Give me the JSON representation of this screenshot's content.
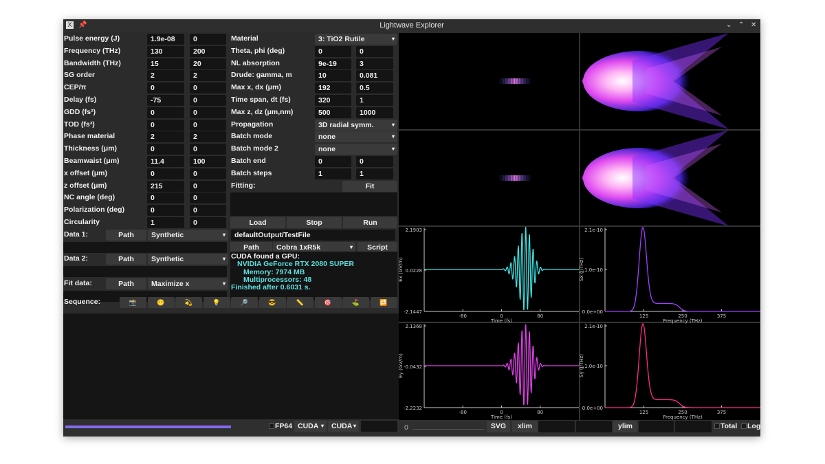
{
  "window": {
    "title": "Lightwave Explorer",
    "controls": [
      "minimize",
      "maximize",
      "close"
    ]
  },
  "left_fields": [
    {
      "label": "Pulse energy (J)",
      "v1": "1.9e-08",
      "v2": "0"
    },
    {
      "label": "Frequency (THz)",
      "v1": "130",
      "v2": "200"
    },
    {
      "label": "Bandwidth (THz)",
      "v1": "15",
      "v2": "20"
    },
    {
      "label": "SG order",
      "v1": "2",
      "v2": "2"
    },
    {
      "label": "CEP/π",
      "v1": "0",
      "v2": "0"
    },
    {
      "label": "Delay (fs)",
      "v1": "-75",
      "v2": "0"
    },
    {
      "label": "GDD (fs²)",
      "v1": "0",
      "v2": "0"
    },
    {
      "label": "TOD (fs³)",
      "v1": "0",
      "v2": "0"
    },
    {
      "label": "Phase material",
      "v1": "2",
      "v2": "2"
    },
    {
      "label": "Thickness (μm)",
      "v1": "0",
      "v2": "0"
    },
    {
      "label": "Beamwaist (μm)",
      "v1": "11.4",
      "v2": "100"
    },
    {
      "label": "x offset (μm)",
      "v1": "0",
      "v2": "0"
    },
    {
      "label": "z offset (μm)",
      "v1": "215",
      "v2": "0"
    },
    {
      "label": "NC angle (deg)",
      "v1": "0",
      "v2": "0"
    },
    {
      "label": "Polarization (deg)",
      "v1": "0",
      "v2": "0"
    },
    {
      "label": "Circularity",
      "v1": "1",
      "v2": "0"
    }
  ],
  "mid_fields": [
    {
      "label": "Material",
      "select": "3: TiO2 Rutile"
    },
    {
      "label": "Theta, phi (deg)",
      "v1": "0",
      "v2": "0"
    },
    {
      "label": "NL absorption",
      "v1": "9e-19",
      "v2": "3"
    },
    {
      "label": "Drude: gamma, m",
      "v1": "10",
      "v2": "0.081"
    },
    {
      "label": "Max x, dx (μm)",
      "v1": "192",
      "v2": "0.5"
    },
    {
      "label": "Time span, dt (fs)",
      "v1": "320",
      "v2": "1"
    },
    {
      "label": "Max z, dz (μm,nm)",
      "v1": "500",
      "v2": "1000"
    },
    {
      "label": "Propagation",
      "select": "3D radial symm."
    },
    {
      "label": "Batch mode",
      "select": "none"
    },
    {
      "label": "Batch mode 2",
      "select": "none"
    },
    {
      "label": "Batch end",
      "v1": "0",
      "v2": "0"
    },
    {
      "label": "Batch steps",
      "v1": "1",
      "v2": "1"
    }
  ],
  "fitting": {
    "label": "Fitting:",
    "fit_button": "Fit",
    "text": ""
  },
  "run_buttons": {
    "load": "Load",
    "stop": "Stop",
    "run": "Run"
  },
  "data_rows": [
    {
      "label": "Data 1:",
      "path_button": "Path",
      "select": "Synthetic",
      "path": ""
    },
    {
      "label": "Data 2:",
      "path_button": "Path",
      "select": "Synthetic",
      "path": ""
    },
    {
      "label": "Fit data:",
      "path_button": "Path",
      "select": "Maximize x",
      "path": ""
    }
  ],
  "output": {
    "file": "defaultOutput/TestFile",
    "path_button": "Path",
    "cluster_select": "Cobra 1xR5k",
    "script_button": "Script"
  },
  "console": {
    "lines": [
      {
        "text": "CUDA found a GPU:",
        "indent": 0,
        "kind": "h"
      },
      {
        "text": "NVIDIA GeForce RTX 2080 SUPER",
        "indent": 1,
        "kind": "c"
      },
      {
        "text": "Memory: 7974 MB",
        "indent": 2,
        "kind": "c"
      },
      {
        "text": "Multiprocessors: 48",
        "indent": 2,
        "kind": "c"
      },
      {
        "text": "Finished after 0.6031 s.",
        "indent": 0,
        "kind": "c"
      }
    ]
  },
  "sequence": {
    "label": "Sequence:",
    "buttons": [
      {
        "name": "camera",
        "glyph": "📸"
      },
      {
        "name": "pause-face",
        "glyph": "😶"
      },
      {
        "name": "dizzy",
        "glyph": "💫"
      },
      {
        "name": "light-bulb",
        "glyph": "💡"
      },
      {
        "name": "magnifier",
        "glyph": "🔎"
      },
      {
        "name": "sunglasses",
        "glyph": "😎"
      },
      {
        "name": "ruler",
        "glyph": "📏"
      },
      {
        "name": "target",
        "glyph": "🎯"
      },
      {
        "name": "golf-flag",
        "glyph": "⛳"
      },
      {
        "name": "repeat",
        "glyph": "🔁"
      }
    ]
  },
  "bottom": {
    "progress": 1.0,
    "progress_color": "#9b59ff",
    "fp64_label": "FP64",
    "fp64_checked": false,
    "primary_backend": "CUDA",
    "secondary_backend": "CUDA",
    "backend_field": "",
    "slider_value": "0",
    "svg_button": "SVG",
    "xlim_button": "xlim",
    "xlim_min": "",
    "xlim_max": "",
    "ylim_button": "ylim",
    "ylim_min": "",
    "ylim_max": "",
    "total_label": "Total",
    "total_checked": false,
    "log_label": "Log",
    "log_checked": false
  },
  "colors": {
    "ex": "#3ee0e0",
    "ey": "#e040e8",
    "sx": "#a040ff",
    "sy": "#ff2a8a",
    "beam_core": "#ff9cf0",
    "beam_edge": "#5a2cff"
  },
  "chart_data": [
    {
      "type": "line",
      "ylabel": "Ex (GV/m)",
      "xlabel": "Time (fs)",
      "xlim": [
        -160,
        160
      ],
      "x_ticks": [
        "-80",
        "0",
        "80"
      ],
      "y_ticks": [
        "2.1903",
        "0.0228",
        "-2.1447"
      ],
      "ylim": [
        -2.1447,
        2.1903
      ],
      "series": [
        {
          "color": "#3ee0e0",
          "center_fs": 50,
          "peak": 2.19,
          "carrier_THz": 130
        }
      ]
    },
    {
      "type": "line",
      "ylabel": "Sx (J/THz)",
      "xlabel": "Frequency (THz)",
      "xlim": [
        0,
        500
      ],
      "x_ticks": [
        "125",
        "250",
        "375"
      ],
      "y_ticks": [
        "2.1e-10",
        "1.0e-10",
        "0.0e+00"
      ],
      "ylim": [
        0,
        2.1e-10
      ],
      "series": [
        {
          "color": "#a040ff",
          "peak_THz": 122,
          "peak": 2.1e-10,
          "shoulder": 2e-11
        }
      ]
    },
    {
      "type": "line",
      "ylabel": "Ey (GV/m)",
      "xlabel": "Time (fs)",
      "xlim": [
        -160,
        160
      ],
      "x_ticks": [
        "-80",
        "0",
        "80"
      ],
      "y_ticks": [
        "2.1368",
        "-0.0432",
        "-2.2232"
      ],
      "ylim": [
        -2.2232,
        2.1368
      ],
      "series": [
        {
          "color": "#e040e8",
          "center_fs": 50,
          "peak": 2.14,
          "carrier_THz": 130
        }
      ]
    },
    {
      "type": "line",
      "ylabel": "Sy (J/THz)",
      "xlabel": "Frequency (THz)",
      "xlim": [
        0,
        500
      ],
      "x_ticks": [
        "125",
        "250",
        "375"
      ],
      "y_ticks": [
        "2.1e-10",
        "1.0e-10",
        "0.0e+00"
      ],
      "ylim": [
        0,
        2.1e-10
      ],
      "series": [
        {
          "color": "#ff2a8a",
          "peak_THz": 122,
          "peak": 2.1e-10,
          "shoulder": 2e-11
        }
      ]
    }
  ]
}
